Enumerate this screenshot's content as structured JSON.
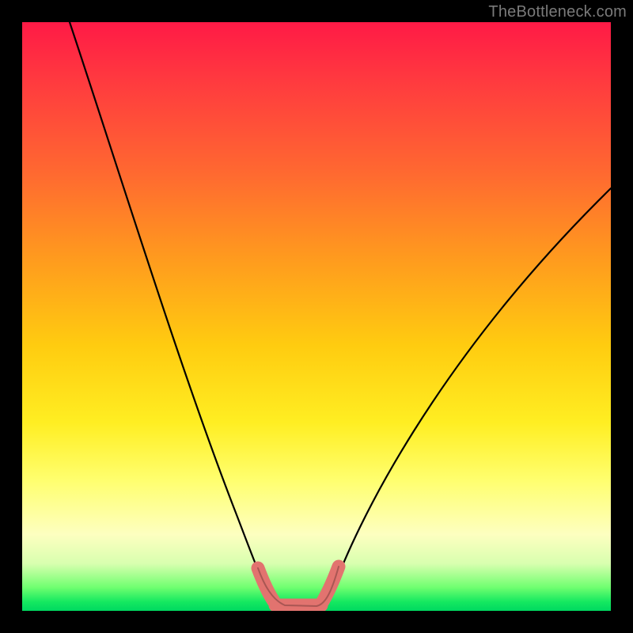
{
  "watermark": "TheBottleneck.com",
  "chart_data": {
    "type": "line",
    "title": "",
    "xlabel": "",
    "ylabel": "",
    "xlim": [
      0,
      100
    ],
    "ylim": [
      0,
      100
    ],
    "series": [
      {
        "name": "bottleneck-curve",
        "x": [
          8,
          12,
          16,
          20,
          24,
          28,
          32,
          36,
          40,
          41,
          43,
          45,
          47,
          49,
          51,
          52,
          55,
          60,
          65,
          70,
          75,
          80,
          85,
          90,
          95,
          100
        ],
        "values": [
          100,
          88,
          76,
          65,
          54,
          44,
          34,
          24,
          12,
          8,
          4,
          2,
          1,
          1,
          2,
          6,
          13,
          22,
          30,
          37,
          43,
          48,
          53,
          57,
          60,
          63
        ]
      },
      {
        "name": "highlight-segment",
        "x": [
          40,
          41,
          42,
          43,
          44,
          45,
          46,
          47,
          48,
          49,
          50,
          51,
          52
        ],
        "values": [
          9,
          7,
          5,
          3.5,
          2.5,
          2,
          1.8,
          1.8,
          2,
          2.2,
          3,
          5,
          8
        ]
      }
    ],
    "colors": {
      "curve": "#000000",
      "highlight": "#e66a6a",
      "gradient_top": "#ff1a46",
      "gradient_bottom": "#00d860"
    }
  }
}
